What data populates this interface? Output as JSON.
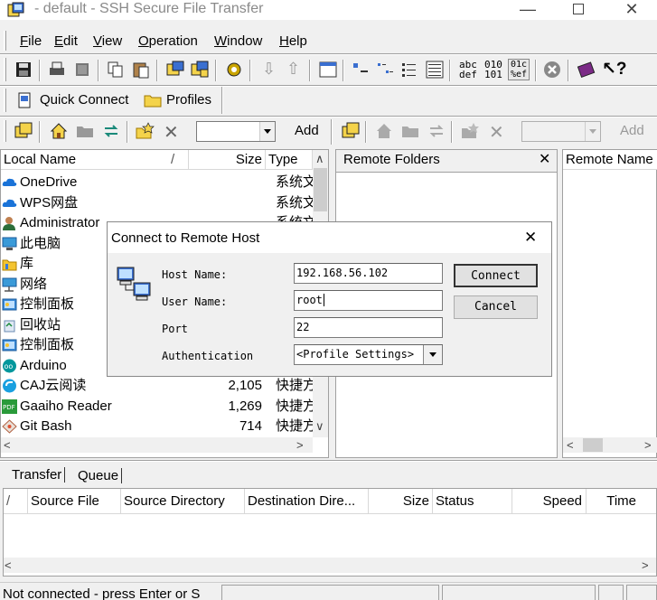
{
  "window": {
    "title": "- default - SSH Secure File Transfer"
  },
  "menu": [
    {
      "label": "File",
      "u": "F",
      "rest": "ile"
    },
    {
      "label": "Edit",
      "u": "E",
      "rest": "dit"
    },
    {
      "label": "View",
      "u": "V",
      "rest": "iew"
    },
    {
      "label": "Operation",
      "u": "O",
      "rest": "peration"
    },
    {
      "label": "Window",
      "u": "W",
      "rest": "indow"
    },
    {
      "label": "Help",
      "u": "H",
      "rest": "elp"
    }
  ],
  "toolbar": {
    "quick_connect": "Quick Connect",
    "profiles": "Profiles",
    "add_left": "Add",
    "add_right": "Add"
  },
  "local": {
    "columns": [
      "Local Name",
      "Size",
      "Type"
    ],
    "sort_mark": "/",
    "files": [
      {
        "name": "OneDrive",
        "size": "",
        "type": "系统文",
        "icon": "cloud-icon"
      },
      {
        "name": "WPS网盘",
        "size": "",
        "type": "系统文",
        "icon": "cloud-icon"
      },
      {
        "name": "Administrator",
        "size": "",
        "type": "系统文",
        "icon": "user-icon"
      },
      {
        "name": "此电脑",
        "size": "",
        "type": "",
        "icon": "computer-icon"
      },
      {
        "name": "库",
        "size": "",
        "type": "",
        "icon": "library-icon"
      },
      {
        "name": "网络",
        "size": "",
        "type": "",
        "icon": "network-icon"
      },
      {
        "name": "控制面板",
        "size": "",
        "type": "",
        "icon": "control-panel-icon"
      },
      {
        "name": "回收站",
        "size": "",
        "type": "",
        "icon": "recycle-bin-icon"
      },
      {
        "name": "控制面板",
        "size": "",
        "type": "",
        "icon": "control-panel-icon"
      },
      {
        "name": "Arduino",
        "size": "",
        "type": "",
        "icon": "arduino-icon"
      },
      {
        "name": "CAJ云阅读",
        "size": "2,105",
        "type": "快捷方",
        "icon": "caj-icon"
      },
      {
        "name": "Gaaiho Reader",
        "size": "1,269",
        "type": "快捷方",
        "icon": "pdf-icon"
      },
      {
        "name": "Git Bash",
        "size": "714",
        "type": "快捷方",
        "icon": "git-icon"
      }
    ]
  },
  "remote": {
    "folders_title": "Remote Folders",
    "name_column": "Remote Name"
  },
  "dialog": {
    "title": "Connect to Remote Host",
    "host_label": "Host Name:",
    "host_value": "192.168.56.102",
    "user_label": "User Name:",
    "user_value": "root",
    "port_label": "Port",
    "port_value": "22",
    "auth_label": "Authentication",
    "auth_value": "<Profile Settings>",
    "connect": "Connect",
    "cancel": "Cancel"
  },
  "transfer": {
    "tabs": [
      "Transfer",
      "Queue"
    ],
    "columns": [
      "/",
      "Source File",
      "Source Directory",
      "Destination Dire...",
      "Size",
      "Status",
      "Speed",
      "Time"
    ]
  },
  "status": {
    "text": "Not connected - press Enter or S"
  }
}
